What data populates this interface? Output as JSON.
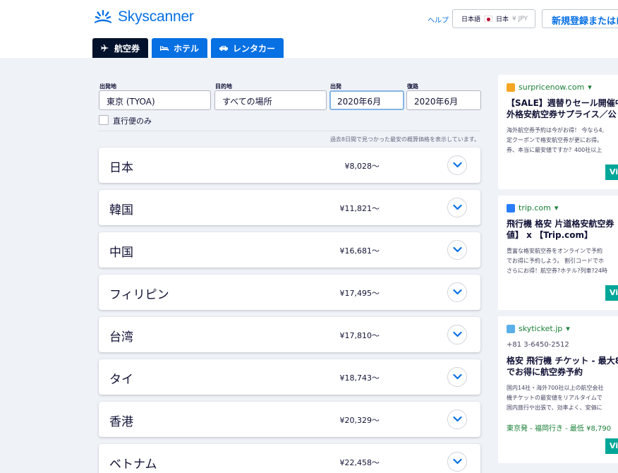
{
  "header": {
    "logo_text": "Skyscanner",
    "help_label": "ヘルプ",
    "locale": {
      "language": "日本語",
      "country": "日本",
      "currency": "¥ JPY"
    },
    "signup_label": "新規登録またはロ"
  },
  "tabs": [
    {
      "label": "航空券",
      "icon": "plane-icon",
      "active": true
    },
    {
      "label": "ホテル",
      "icon": "bed-icon",
      "active": false
    },
    {
      "label": "レンタカー",
      "icon": "car-icon",
      "active": false
    }
  ],
  "search": {
    "origin": {
      "label": "出発地",
      "value": "東京 (TYOA)"
    },
    "destination": {
      "label": "目的地",
      "value": "すべての場所"
    },
    "depart": {
      "label": "出発",
      "value": "2020年6月"
    },
    "return": {
      "label": "復路",
      "value": "2020年6月"
    },
    "direct_only_label": "直行便のみ",
    "direct_only_checked": false
  },
  "results_note": "過去8日間で見つかった最安の概算価格を表示しています。",
  "destinations": [
    {
      "name": "日本",
      "price": "¥8,028～"
    },
    {
      "name": "韓国",
      "price": "¥11,821～"
    },
    {
      "name": "中国",
      "price": "¥16,681～"
    },
    {
      "name": "フィリピン",
      "price": "¥17,495～"
    },
    {
      "name": "台湾",
      "price": "¥17,810～"
    },
    {
      "name": "タイ",
      "price": "¥18,743～"
    },
    {
      "name": "香港",
      "price": "¥20,329～"
    },
    {
      "name": "ベトナム",
      "price": "¥22,458～"
    }
  ],
  "ads": [
    {
      "site": "surpricenow.com",
      "title": "【SALE】週替りセール開催中\n外格安航空券サプライス／公",
      "description": "海外航空券予約は今がお得！ 今なら4,\n定クーポンで格安航空券が更にお得。\n券、本当に最安値ですか？400社以上",
      "visit_label": "Vi"
    },
    {
      "site": "trip.com",
      "title": "飛行機 格安 片道格安航空券\n値】 x 【Trip.com】",
      "description": "豊富な格安航空券をオンラインで予約\nでお得に予約しよう。 割引コードでホ\nさらにお得！航空券?ホテル?列車?24時",
      "visit_label": "Vi"
    },
    {
      "site": "skyticket.jp",
      "phone": "+81 3-6450-2512",
      "title": "格安 飛行機 チケット - 最大8\nでお得に航空券予約",
      "description": "国内14社・海外700社以上の航空会社\n機チケットの最安値をリアルタイムで\n国内旅行や出張で、効率よく、安価に",
      "route": "東京発 - 福岡行き - 最低 ¥8,790",
      "visit_label": "Vi"
    }
  ],
  "colors": {
    "brand": "#0770e3",
    "nav_dark": "#02122c",
    "page_bg": "#eff3f8",
    "ad_green": "#1a7f37",
    "visit_teal": "#00a698"
  }
}
